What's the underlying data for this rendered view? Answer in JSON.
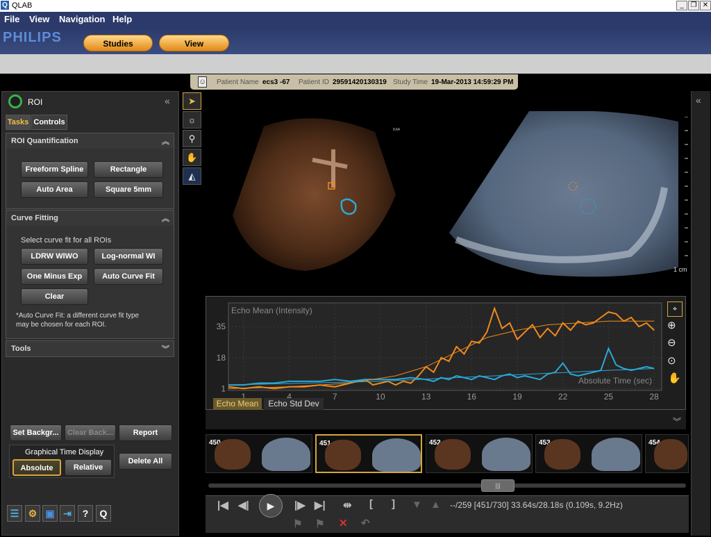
{
  "window": {
    "title": "QLAB",
    "app_icon": "Q",
    "controls": [
      "_",
      "❐",
      "✕"
    ]
  },
  "menu": [
    "File",
    "View",
    "Navigation",
    "Help"
  ],
  "brand": {
    "logo": "PHILIPS",
    "tabs": [
      "Studies",
      "View"
    ]
  },
  "patient": {
    "name_label": "Patient Name",
    "name": "ecs3 -67",
    "id_label": "Patient ID",
    "id": "29591420130319",
    "time_label": "Study Time",
    "time": "19-Mar-2013 14:59:29 PM"
  },
  "left_panel": {
    "title": "ROI",
    "collapse_icon": "«",
    "tabs": [
      "Tasks",
      "Controls"
    ],
    "roi_quant": {
      "title": "ROI Quantification",
      "buttons": [
        "Freeform Spline",
        "Rectangle",
        "Auto Area",
        "Square 5mm"
      ]
    },
    "curve_fitting": {
      "title": "Curve Fitting",
      "subtitle": "Select curve fit for all ROIs",
      "buttons": [
        "LDRW WIWO",
        "Log-normal WI",
        "One Minus Exp",
        "Auto Curve Fit",
        "Clear"
      ],
      "note_line1": "*Auto Curve Fit: a different curve fit type",
      "note_line2": "may be chosen for each ROI."
    },
    "tools": {
      "title": "Tools"
    },
    "bottom": {
      "set_background": "Set Backgr...",
      "clear_background": "Clear Back...",
      "report": "Report",
      "time_display_label": "Graphical Time Display",
      "absolute": "Absolute",
      "relative": "Relative",
      "delete_all": "Delete All"
    }
  },
  "image": {
    "marker": "0.64",
    "scale_label": "1 cm"
  },
  "chart_data": {
    "type": "line",
    "ylabel": "Echo Mean (Intensity)",
    "xlabel": "Absolute Time (sec)",
    "x_ticks": [
      1,
      4,
      7,
      10,
      13,
      16,
      19,
      22,
      25,
      28
    ],
    "y_ticks": [
      1,
      18,
      35
    ],
    "xlim": [
      0,
      28.5
    ],
    "ylim": [
      0,
      48
    ],
    "series": [
      {
        "color": "#f08a1c",
        "x": [
          0,
          1,
          2,
          3,
          4,
          5,
          6,
          7,
          8,
          9,
          9.5,
          10,
          10.5,
          11,
          11.5,
          12,
          12.5,
          13,
          13.5,
          14,
          14.5,
          15,
          15.5,
          16,
          16.5,
          17,
          17.5,
          18,
          18.5,
          19,
          19.5,
          20,
          20.5,
          21,
          21.5,
          22,
          22.5,
          23,
          23.5,
          24,
          24.5,
          25,
          25.5,
          26,
          26.5,
          27,
          27.5,
          28
        ],
        "y": [
          2,
          1,
          2,
          1,
          2,
          2,
          3,
          2,
          4,
          6,
          3,
          4,
          5,
          3,
          5,
          4,
          8,
          13,
          10,
          18,
          16,
          24,
          20,
          27,
          26,
          32,
          45,
          34,
          37,
          28,
          32,
          36,
          29,
          34,
          30,
          37,
          33,
          38,
          36,
          37,
          40,
          43,
          42,
          38,
          40,
          35,
          37,
          33
        ]
      },
      {
        "color": "#2ba8d8",
        "x": [
          0,
          1,
          2,
          3,
          4,
          5,
          6,
          7,
          8,
          9,
          10,
          11,
          12,
          13,
          13.5,
          14,
          14.5,
          15,
          15.5,
          16,
          16.5,
          17,
          17.5,
          18,
          18.5,
          19,
          19.5,
          20,
          20.5,
          21,
          21.5,
          22,
          22.5,
          23,
          23.5,
          24,
          24.5,
          25,
          25.5,
          26,
          26.5,
          27,
          27.5,
          28
        ],
        "y": [
          3,
          3,
          4,
          4,
          5,
          5,
          5,
          6,
          5,
          6,
          6,
          6,
          7,
          6,
          5,
          7,
          6,
          8,
          7,
          6,
          8,
          7,
          6,
          8,
          9,
          7,
          8,
          7,
          6,
          9,
          10,
          15,
          9,
          8,
          9,
          10,
          11,
          23,
          14,
          12,
          11,
          12,
          13,
          12
        ]
      },
      {
        "color": "#f08a1c",
        "x": [
          0,
          4,
          8,
          11,
          13,
          15,
          17,
          19,
          21,
          23,
          25,
          28
        ],
        "y": [
          1,
          2,
          4,
          8,
          13,
          21,
          29,
          33,
          36,
          37,
          38,
          38
        ]
      },
      {
        "color": "#2ba8d8",
        "x": [
          0,
          5,
          10,
          15,
          20,
          25,
          28
        ],
        "y": [
          3,
          4,
          5,
          7,
          9,
          11,
          12
        ]
      }
    ]
  },
  "chart_tabs": [
    "Echo Mean",
    "Echo Std Dev"
  ],
  "thumbnails": [
    "450",
    "451",
    "452",
    "453",
    "454"
  ],
  "transport": {
    "status": "--/259  [451/730]  33.64s/28.18s (0.109s, 9.2Hz)"
  }
}
